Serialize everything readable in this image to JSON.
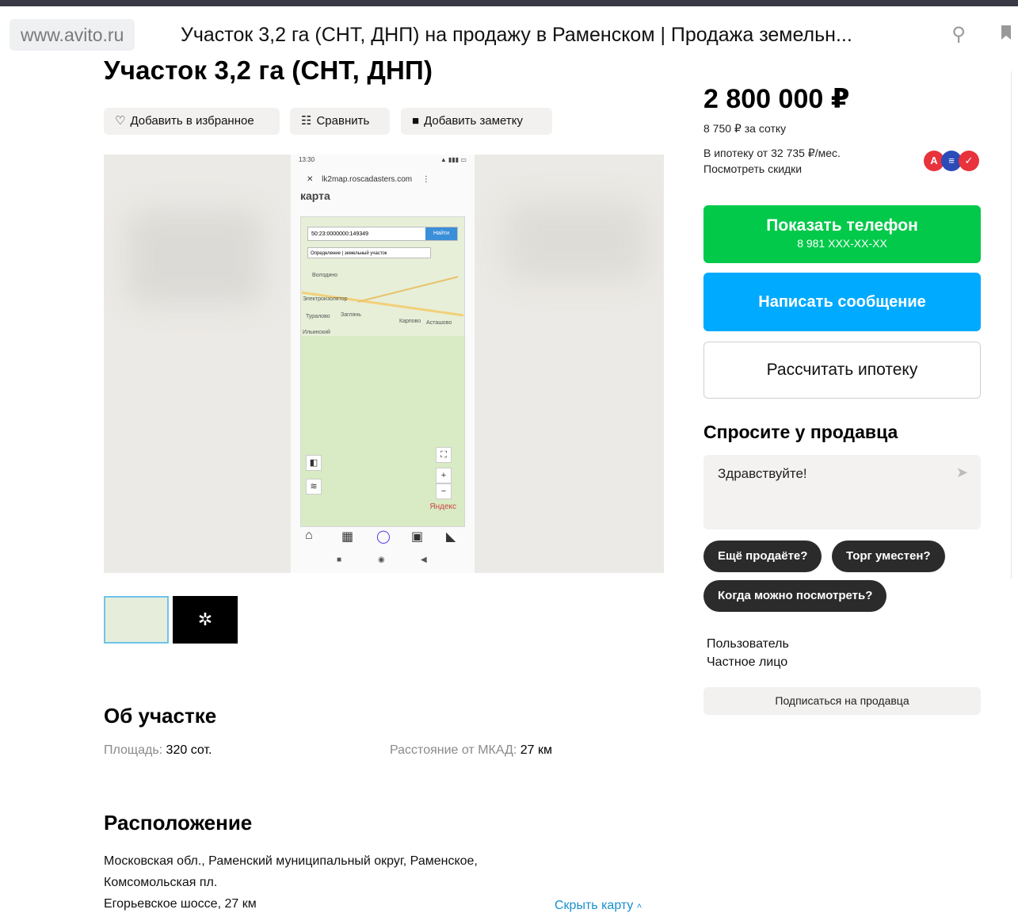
{
  "browser": {
    "domain": "www.avito.ru",
    "tab_title": "Участок 3,2 га (СНТ, ДНП) на продажу в Раменском | Продажа земельн...",
    "icons": [
      "pin-off-icon",
      "bookmark-icon"
    ]
  },
  "listing": {
    "title": "Участок 3,2 га (СНТ, ДНП)",
    "actions": {
      "favorite": "Добавить в избранное",
      "compare": "Сравнить",
      "note": "Добавить заметку"
    }
  },
  "gallery": {
    "phone_url": "lk2map.roscadasters.com",
    "phone_page_title": "карта",
    "phone_search_value": "50:23:0000000:149349",
    "phone_search_button": "Найти",
    "phone_select": "Определение | земельный участок",
    "phone_map_brand": "Яндекс",
    "phone_time": "13:30",
    "towns": [
      "Володино",
      "Электроизолятор",
      "Туралово",
      "Заглянь",
      "Карпово",
      "Асташово",
      "Ильинский"
    ]
  },
  "about": {
    "heading": "Об участке",
    "area_label": "Площадь:",
    "area_value": "320 сот.",
    "distance_label": "Расстояние от МКАД:",
    "distance_value": "27 км"
  },
  "location": {
    "heading": "Расположение",
    "address_line1": "Московская обл., Раменский муниципальный округ, Раменское,",
    "address_line2": "Комсомольская пл.",
    "highway": "Егорьевское шоссе, 27 км",
    "hide_map": "Скрыть карту"
  },
  "sidebar": {
    "price": "2 800 000 ₽",
    "price_per_unit": "8 750 ₽ за сотку",
    "mortgage_from": "В ипотеку от 32 735 ₽/мес.",
    "discounts_link": "Посмотреть скидки",
    "show_phone": "Показать телефон",
    "phone_masked": "8 981 XXX-XX-XX",
    "write_message": "Написать сообщение",
    "calc_mortgage": "Рассчитать ипотеку",
    "ask_title": "Спросите у продавца",
    "ask_placeholder": "Здравствуйте!",
    "chips": [
      "Ещё продаёте?",
      "Торг уместен?",
      "Когда можно посмотреть?"
    ],
    "seller_name": "Пользователь",
    "seller_type": "Частное лицо",
    "subscribe": "Подписаться на продавца",
    "colors": {
      "green": "#02c94a",
      "blue": "#00aaff"
    }
  }
}
